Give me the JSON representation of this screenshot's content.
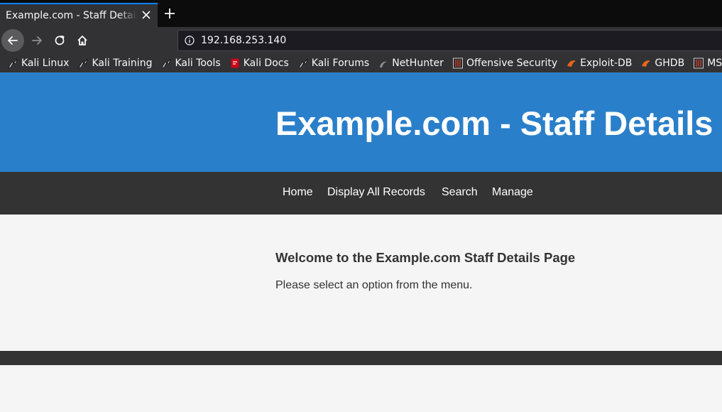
{
  "browser": {
    "tab_title": "Example.com - Staff Details",
    "url": "192.168.253.140",
    "colors": {
      "tab_accent": "#0a84ff",
      "toolbar": "#323234"
    }
  },
  "bookmarks": [
    {
      "label": "Kali Linux",
      "icon": "kali-dragon-icon"
    },
    {
      "label": "Kali Training",
      "icon": "kali-dragon-icon"
    },
    {
      "label": "Kali Tools",
      "icon": "kali-dragon-icon"
    },
    {
      "label": "Kali Docs",
      "icon": "kali-docs-icon"
    },
    {
      "label": "Kali Forums",
      "icon": "kali-dragon-icon"
    },
    {
      "label": "NetHunter",
      "icon": "nethunter-icon"
    },
    {
      "label": "Offensive Security",
      "icon": "offsec-icon"
    },
    {
      "label": "Exploit-DB",
      "icon": "exploit-db-icon"
    },
    {
      "label": "GHDB",
      "icon": "exploit-db-icon"
    },
    {
      "label": "MSFU",
      "icon": "offsec-icon"
    }
  ],
  "site": {
    "title": "Example.com - Staff Details",
    "nav": [
      "Home",
      "Display All Records",
      "Search",
      "Manage"
    ],
    "welcome_heading": "Welcome to the Example.com Staff Details Page",
    "welcome_text": "Please select an option from the menu.",
    "colors": {
      "header": "#2a7fca",
      "menu": "#333333",
      "background": "#f5f5f5"
    }
  }
}
